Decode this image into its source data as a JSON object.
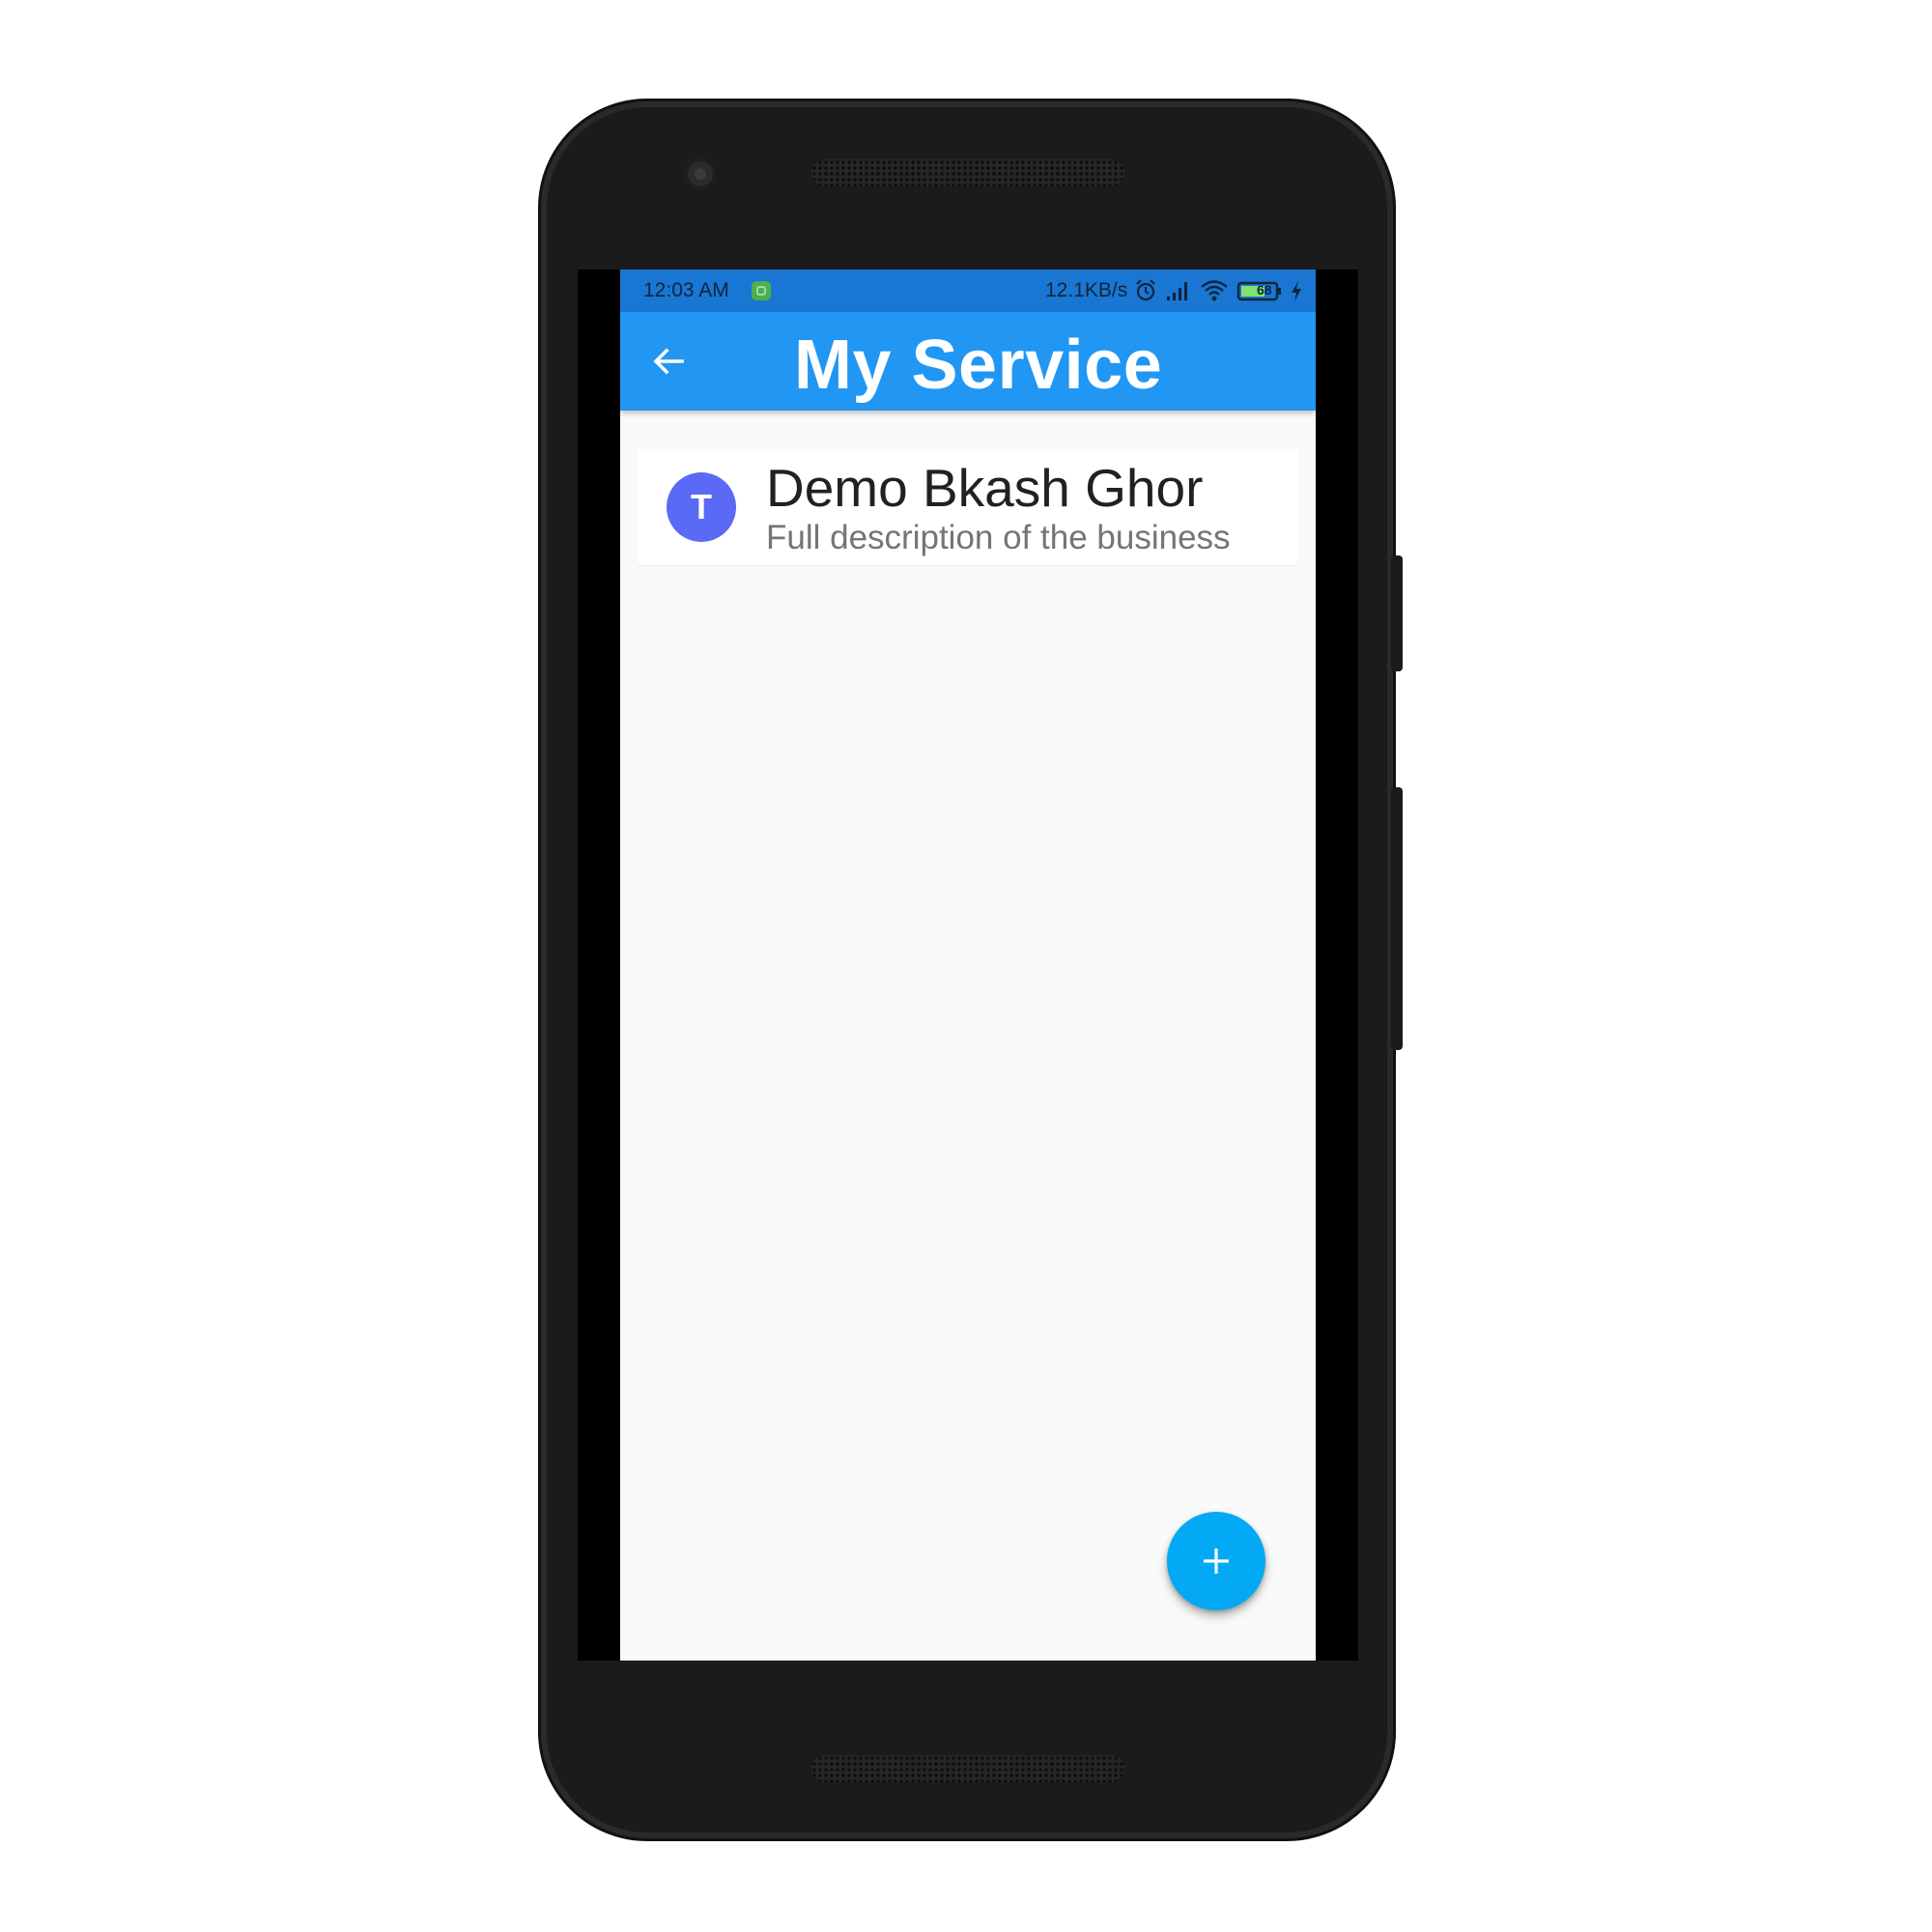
{
  "status_bar": {
    "time": "12:03 AM",
    "network_speed": "12.1KB/s",
    "battery_level": "68",
    "icons": [
      "app-notification-icon",
      "alarm-icon",
      "signal-icon",
      "wifi-icon",
      "battery-icon",
      "charging-icon"
    ]
  },
  "app_bar": {
    "title": "My Service",
    "back_icon": "arrow-back-icon"
  },
  "services": [
    {
      "avatar_letter": "T",
      "title": "Demo Bkash Ghor",
      "subtitle": "Full description of the business"
    }
  ],
  "fab": {
    "icon": "plus-icon"
  },
  "colors": {
    "status_bar": "#1976d2",
    "app_bar": "#2196f3",
    "avatar": "#5b6af5",
    "fab": "#03a9f4",
    "background": "#fafafa"
  }
}
